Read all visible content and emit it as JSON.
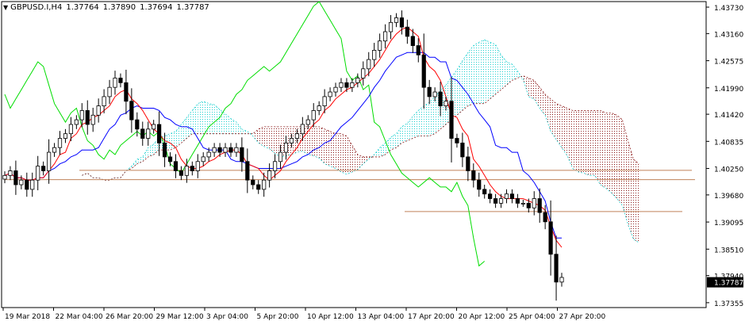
{
  "header": {
    "symbol": "GBPUSD.I,H4",
    "open": "1.37764",
    "high": "1.37890",
    "low": "1.37694",
    "close": "1.37787",
    "menu_glyph": "▼"
  },
  "chart_data": {
    "type": "candlestick",
    "indicator": "Ichimoku Kinko Hyo",
    "y_axis": {
      "ticks": [
        "1.43730",
        "1.43160",
        "1.42575",
        "1.41990",
        "1.41420",
        "1.40835",
        "1.40250",
        "1.39680",
        "1.39095",
        "1.38510",
        "1.37940",
        "1.37355"
      ],
      "current_price_label": "1.37787",
      "ylim": [
        1.3725,
        1.4385
      ]
    },
    "x_axis": {
      "ticks": [
        "19 Mar 2018",
        "22 Mar 04:00",
        "26 Mar 20:00",
        "29 Mar 12:00",
        "3 Apr 04:00",
        "5 Apr 20:00",
        "10 Apr 12:00",
        "13 Apr 04:00",
        "17 Apr 20:00",
        "20 Apr 12:00",
        "25 Apr 04:00",
        "27 Apr 20:00"
      ]
    },
    "close_series": [
      1.401,
      1.402,
      1.399,
      1.4,
      1.398,
      1.4,
      1.403,
      1.402,
      1.406,
      1.407,
      1.409,
      1.41,
      1.412,
      1.413,
      1.415,
      1.412,
      1.414,
      1.416,
      1.418,
      1.42,
      1.422,
      1.421,
      1.417,
      1.413,
      1.411,
      1.409,
      1.411,
      1.412,
      1.408,
      1.405,
      1.404,
      1.402,
      1.401,
      1.403,
      1.402,
      1.404,
      1.405,
      1.406,
      1.407,
      1.406,
      1.407,
      1.406,
      1.407,
      1.404,
      1.4,
      1.399,
      1.398,
      1.4,
      1.402,
      1.404,
      1.406,
      1.408,
      1.409,
      1.41,
      1.412,
      1.413,
      1.415,
      1.416,
      1.418,
      1.419,
      1.42,
      1.421,
      1.42,
      1.421,
      1.422,
      1.424,
      1.426,
      1.428,
      1.43,
      1.432,
      1.434,
      1.435,
      1.433,
      1.431,
      1.429,
      1.427,
      1.42,
      1.418,
      1.419,
      1.416,
      1.417,
      1.409,
      1.408,
      1.405,
      1.402,
      1.4,
      1.398,
      1.397,
      1.396,
      1.395,
      1.396,
      1.397,
      1.396,
      1.395,
      1.395,
      1.394,
      1.396,
      1.393,
      1.391,
      1.384,
      1.378,
      1.379
    ],
    "colors": {
      "candles": "#000000",
      "tenkan_sen": "#ff0000",
      "kijun_sen": "#0000ff",
      "chikou_span": "#00dd00",
      "kumo_bearish": "#8b1a1a",
      "kumo_bullish": "#20d0d0",
      "horizontal_levels": "#c0825a"
    }
  }
}
